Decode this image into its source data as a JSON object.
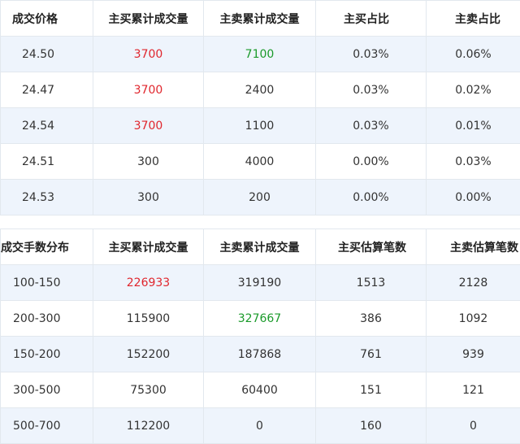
{
  "price_table": {
    "headers": [
      "成交价格",
      "主买累计成交量",
      "主卖累计成交量",
      "主买占比",
      "主卖占比"
    ],
    "rows": [
      {
        "price": "24.50",
        "buy_vol": "3700",
        "sell_vol": "7100",
        "buy_pct": "0.03%",
        "sell_pct": "0.06%"
      },
      {
        "price": "24.47",
        "buy_vol": "3700",
        "sell_vol": "2400",
        "buy_pct": "0.03%",
        "sell_pct": "0.02%"
      },
      {
        "price": "24.54",
        "buy_vol": "3700",
        "sell_vol": "1100",
        "buy_pct": "0.03%",
        "sell_pct": "0.01%"
      },
      {
        "price": "24.51",
        "buy_vol": "300",
        "sell_vol": "4000",
        "buy_pct": "0.00%",
        "sell_pct": "0.03%"
      },
      {
        "price": "24.53",
        "buy_vol": "300",
        "sell_vol": "200",
        "buy_pct": "0.00%",
        "sell_pct": "0.00%"
      }
    ]
  },
  "lot_table": {
    "headers": [
      "成交手数分布",
      "主买累计成交量",
      "主卖累计成交量",
      "主买估算笔数",
      "主卖估算笔数"
    ],
    "rows": [
      {
        "range": "100-150",
        "buy_vol": "226933",
        "sell_vol": "319190",
        "buy_cnt": "1513",
        "sell_cnt": "2128"
      },
      {
        "range": "200-300",
        "buy_vol": "115900",
        "sell_vol": "327667",
        "buy_cnt": "386",
        "sell_cnt": "1092"
      },
      {
        "range": "150-200",
        "buy_vol": "152200",
        "sell_vol": "187868",
        "buy_cnt": "761",
        "sell_cnt": "939"
      },
      {
        "range": "300-500",
        "buy_vol": "75300",
        "sell_vol": "60400",
        "buy_cnt": "151",
        "sell_cnt": "121"
      },
      {
        "range": "500-700",
        "buy_vol": "112200",
        "sell_vol": "0",
        "buy_cnt": "160",
        "sell_cnt": "0"
      }
    ]
  },
  "colors": {
    "highlight_red": "#e0262d",
    "highlight_green": "#1a9a2a",
    "row_stripe": "#eef4fc",
    "grid_line": "#e2e8ee"
  }
}
